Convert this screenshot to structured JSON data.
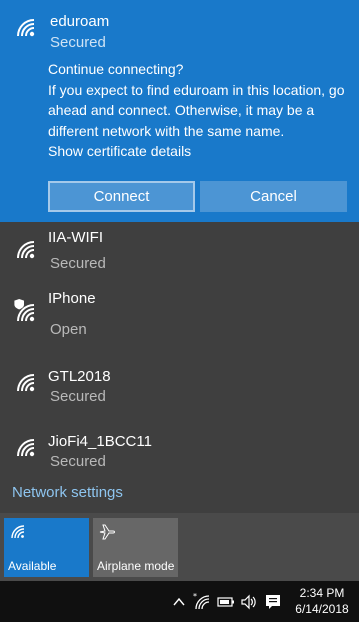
{
  "selected_network": {
    "name": "eduroam",
    "status": "Secured",
    "message_lines": [
      "Continue connecting?",
      "If you expect to find eduroam in this location, go ahead and connect. Otherwise, it may be a different network with the same name."
    ],
    "certificate_link": "Show certificate details",
    "connect_label": "Connect",
    "cancel_label": "Cancel"
  },
  "networks": [
    {
      "name": "IIA-WIFI",
      "status": "Secured"
    },
    {
      "name": "IPhone",
      "status": "Open"
    },
    {
      "name": "GTL2018",
      "status": "Secured"
    },
    {
      "name": "JioFi4_1BCC11",
      "status": "Secured"
    }
  ],
  "network_settings_label": "Network settings",
  "quick_actions": {
    "wifi_label": "Available",
    "airplane_label": "Airplane mode"
  },
  "taskbar": {
    "time": "2:34 PM",
    "date": "6/14/2018"
  },
  "colors": {
    "accent": "#1979ca",
    "flyout_bg": "#3f3f3f",
    "link": "#8ec5ef",
    "taskbar": "#101010"
  }
}
